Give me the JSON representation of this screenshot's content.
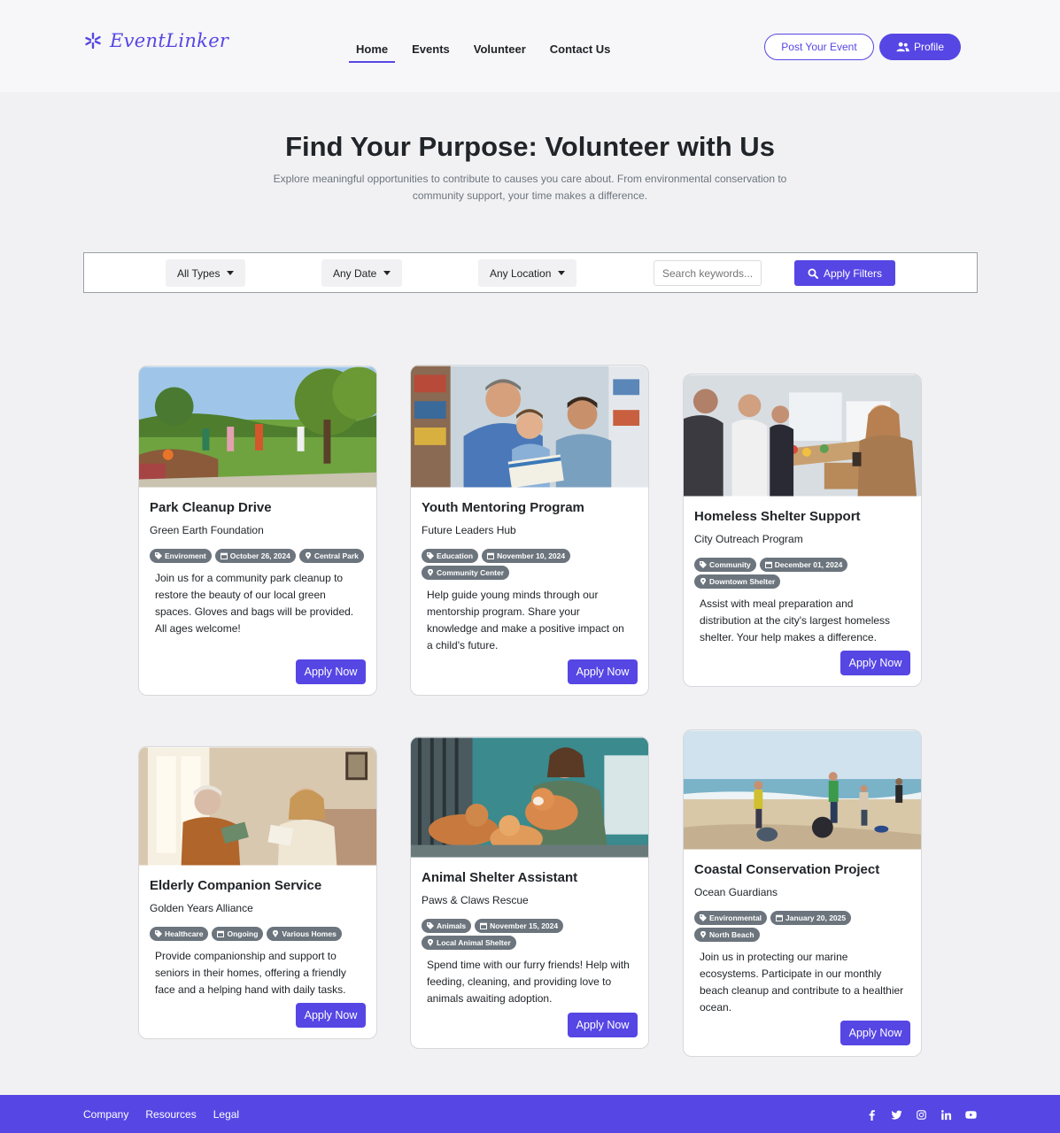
{
  "brand": {
    "name": "EventLinker",
    "accent": "#5646e4"
  },
  "nav": {
    "items": [
      {
        "label": "Home",
        "active": true
      },
      {
        "label": "Events",
        "active": false
      },
      {
        "label": "Volunteer",
        "active": false
      },
      {
        "label": "Contact Us",
        "active": false
      }
    ],
    "post_event_label": "Post Your Event",
    "profile_label": "Profile"
  },
  "hero": {
    "title": "Find Your Purpose: Volunteer with Us",
    "subtitle": "Explore meaningful opportunities to contribute to causes you care about. From environmental conservation to community support, your time makes a difference."
  },
  "filters": {
    "type": "All Types",
    "date": "Any Date",
    "location": "Any Location",
    "search_placeholder": "Search keywords...",
    "apply_label": "Apply Filters"
  },
  "cards": [
    {
      "title": "Park Cleanup Drive",
      "org": "Green Earth Foundation",
      "category": "Enviroment",
      "date": "October 26, 2024",
      "location": "Central Park",
      "description": "Join us for a community park cleanup to restore the beauty of our local green spaces. Gloves and bags will be provided. All ages welcome!",
      "button": "Apply Now",
      "image": "park-cleanup-photo"
    },
    {
      "title": "Youth Mentoring Program",
      "org": "Future Leaders Hub",
      "category": "Education",
      "date": "November 10, 2024",
      "location": "Community Center",
      "description": "Help guide young minds through our mentorship program. Share your knowledge and make a positive impact on a child's future.",
      "button": "Apply Now",
      "image": "mentoring-photo"
    },
    {
      "title": "Homeless Shelter Support",
      "org": "City Outreach Program",
      "category": "Community",
      "date": "December 01, 2024",
      "location": "Downtown Shelter",
      "description": "Assist with meal preparation and distribution at the city's largest homeless shelter. Your help makes a difference.",
      "button": "Apply Now",
      "image": "shelter-photo"
    },
    {
      "title": "Elderly Companion Service",
      "org": "Golden Years Alliance",
      "category": "Healthcare",
      "date": "Ongoing",
      "location": "Various Homes",
      "description": "Provide companionship and support to seniors in their homes, offering a friendly face and a helping hand with daily tasks.",
      "button": "Apply Now",
      "image": "elderly-photo"
    },
    {
      "title": "Animal Shelter Assistant",
      "org": "Paws & Claws Rescue",
      "category": "Animals",
      "date": "November 15, 2024",
      "location": "Local Animal Shelter",
      "description": "Spend time with our furry friends! Help with feeding, cleaning, and providing love to animals awaiting adoption.",
      "button": "Apply Now",
      "image": "animal-shelter-photo"
    },
    {
      "title": "Coastal Conservation Project",
      "org": "Ocean Guardians",
      "category": "Environmental",
      "date": "January 20, 2025",
      "location": "North Beach",
      "description": "Join us in protecting our marine ecosystems. Participate in our monthly beach cleanup and contribute to a healthier ocean.",
      "button": "Apply Now",
      "image": "beach-cleanup-photo"
    }
  ],
  "footer": {
    "links": [
      "Company",
      "Resources",
      "Legal"
    ],
    "socials": [
      "facebook-icon",
      "twitter-icon",
      "instagram-icon",
      "linkedin-icon",
      "youtube-icon"
    ]
  }
}
